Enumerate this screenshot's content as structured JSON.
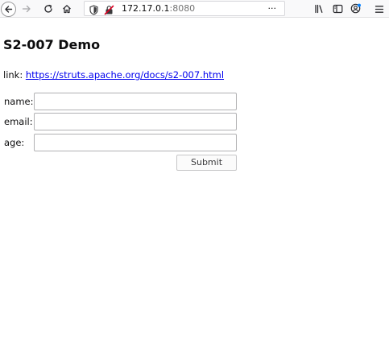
{
  "browser": {
    "url_host": "172.17.0.1",
    "url_port": ":8080",
    "overflow_label": "···",
    "icons": {
      "back": "back-arrow-icon",
      "forward": "forward-arrow-icon",
      "reload": "reload-icon",
      "home": "home-icon",
      "shield": "shield-icon",
      "insecure": "insecure-lock-icon",
      "library": "library-icon",
      "sidebar": "sidebar-icon",
      "account": "account-icon",
      "menu": "hamburger-menu-icon"
    }
  },
  "page": {
    "title": "S2-007 Demo",
    "link_prefix": "link: ",
    "link_text": "https://struts.apache.org/docs/s2-007.html",
    "link_color": "#0000ee"
  },
  "form": {
    "fields": [
      {
        "label": "name:",
        "value": ""
      },
      {
        "label": "email:",
        "value": ""
      },
      {
        "label": "age:",
        "value": ""
      }
    ],
    "submit_label": "Submit"
  }
}
